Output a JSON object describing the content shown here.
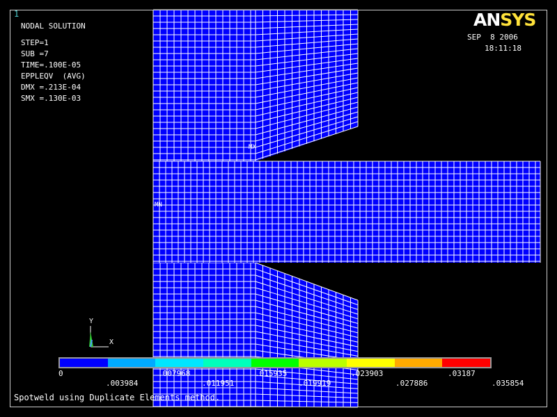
{
  "window": {
    "number": "1"
  },
  "solution_panel": {
    "title": "NODAL SOLUTION",
    "lines": [
      "STEP=1",
      "SUB =7",
      "TIME=.100E-05",
      "EPPLEQV  (AVG)",
      "DMX =.213E-04",
      "SMX =.130E-03"
    ]
  },
  "header": {
    "logo_part1": "AN",
    "logo_part2": "SYS",
    "date": "SEP  8 2006",
    "time": "18:11:18"
  },
  "markers": {
    "max": "MX",
    "min": "MN"
  },
  "triad": {
    "x": "X",
    "y": "Y"
  },
  "legend": {
    "colors": [
      "#0000ff",
      "#00aaff",
      "#00e6ff",
      "#00ffbb",
      "#00ff00",
      "#bbff00",
      "#ffff00",
      "#ffaa00",
      "#ff0000"
    ],
    "labels_bottom_row": [
      "0",
      ".007968",
      ".015935",
      ".023903",
      ".03187"
    ],
    "labels_top_row": [
      ".003984",
      ".011951",
      ".019919",
      ".027886",
      ".035854"
    ]
  },
  "caption": "Spotweld using Duplicate Elements method.",
  "theme": {
    "mesh_fill": "#0000ff",
    "mesh_line": "#ffffff",
    "background": "#000000"
  }
}
